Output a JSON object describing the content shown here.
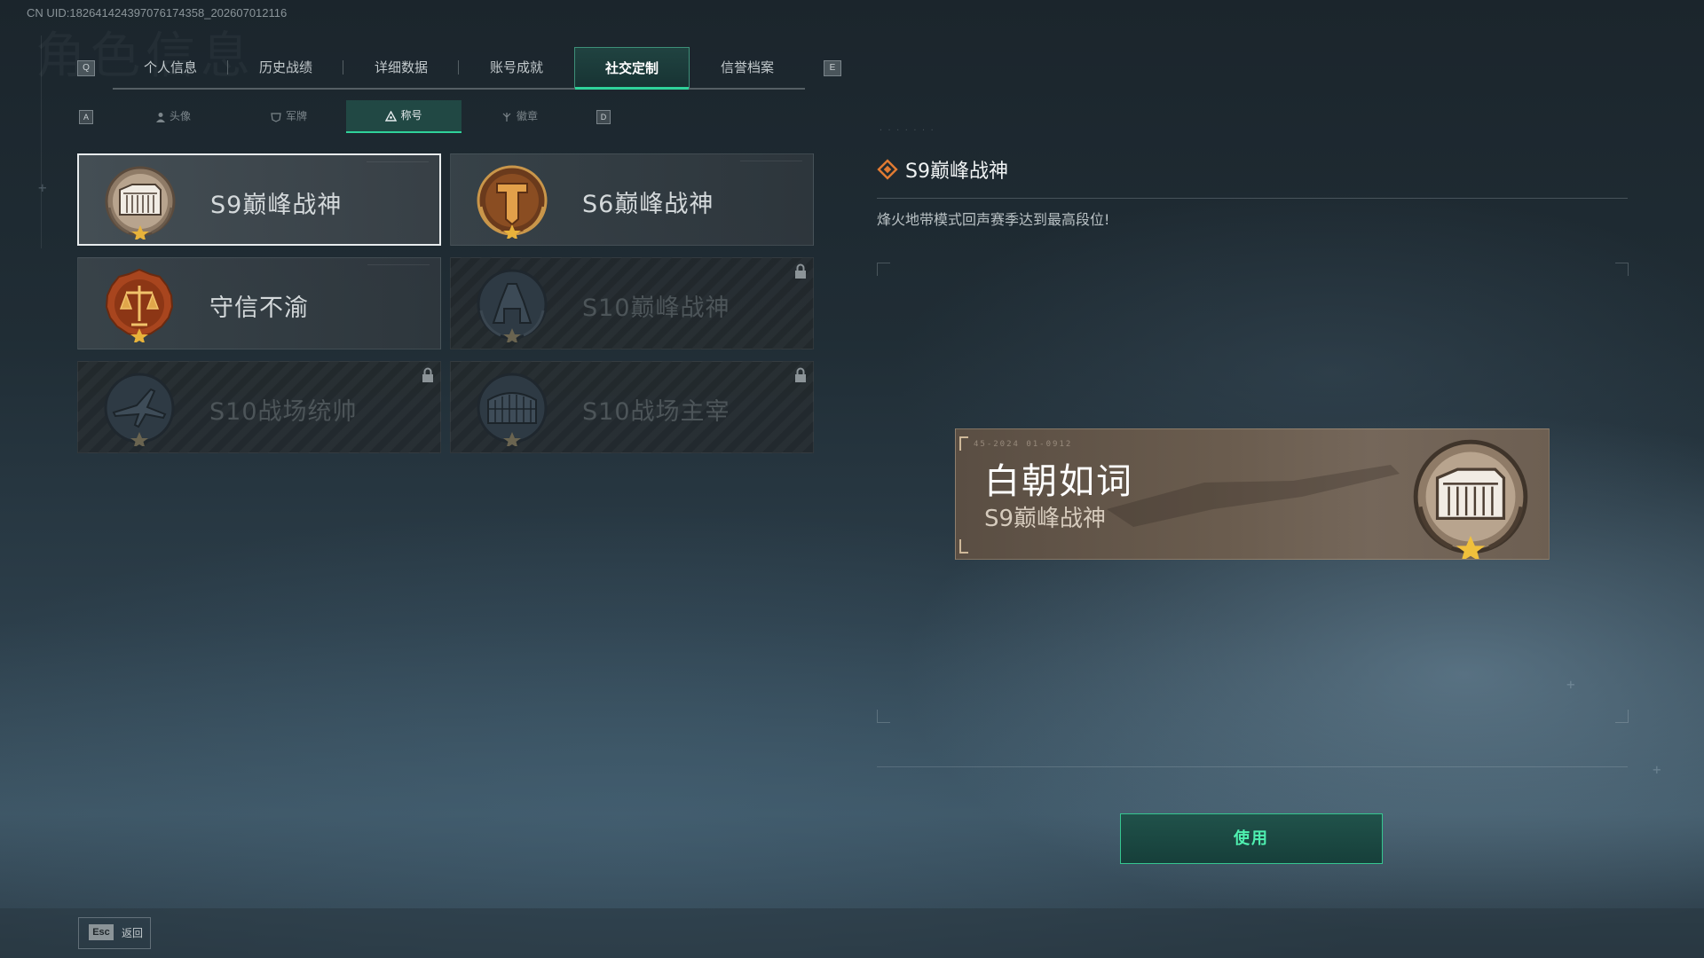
{
  "uid_text": "CN UID:18264142439707617435​8_202607012116",
  "ghost_title": "角色信息",
  "keys": {
    "prev_tab": "Q",
    "next_tab": "E",
    "prev_sub": "A",
    "next_sub": "D"
  },
  "main_tabs": [
    {
      "label": "个人信息",
      "active": false
    },
    {
      "label": "历史战绩",
      "active": false
    },
    {
      "label": "详细数据",
      "active": false
    },
    {
      "label": "账号成就",
      "active": false
    },
    {
      "label": "社交定制",
      "active": true
    },
    {
      "label": "信誉档案",
      "active": false
    }
  ],
  "sub_tabs": [
    {
      "label": "头像",
      "icon": "person-icon",
      "active": false
    },
    {
      "label": "军牌",
      "icon": "dogtag-icon",
      "active": false
    },
    {
      "label": "称号",
      "icon": "triangle-icon",
      "active": true
    },
    {
      "label": "徽章",
      "icon": "emblem-icon",
      "active": false
    }
  ],
  "titles": [
    {
      "name": "S9巅峰战神",
      "badge": "building-badge-icon",
      "selected": true,
      "locked": false
    },
    {
      "name": "S6巅峰战神",
      "badge": "t-emblem-badge-icon",
      "selected": false,
      "locked": false
    },
    {
      "name": "守信不渝",
      "badge": "scales-badge-icon",
      "selected": false,
      "locked": false
    },
    {
      "name": "S10巅峰战神",
      "badge": "tower-badge-icon",
      "selected": false,
      "locked": true
    },
    {
      "name": "S10战场统帅",
      "badge": "aircraft-badge-icon",
      "selected": false,
      "locked": true
    },
    {
      "name": "S10战场主宰",
      "badge": "colosseum-badge-icon",
      "selected": false,
      "locked": true
    }
  ],
  "detail": {
    "title": "S9巅峰战神",
    "description": "烽火地带模式回声赛季达到最高段位!"
  },
  "preview": {
    "player_name": "白朝如词",
    "title": "S9巅峰战神",
    "code": "45-2024 01-0912"
  },
  "use_button": "使用",
  "esc": {
    "key": "Esc",
    "label": "返回"
  },
  "colors": {
    "accent": "#2fd29a",
    "preview_bg": "#6a5c4e",
    "badge_gold": "#c9964a"
  }
}
